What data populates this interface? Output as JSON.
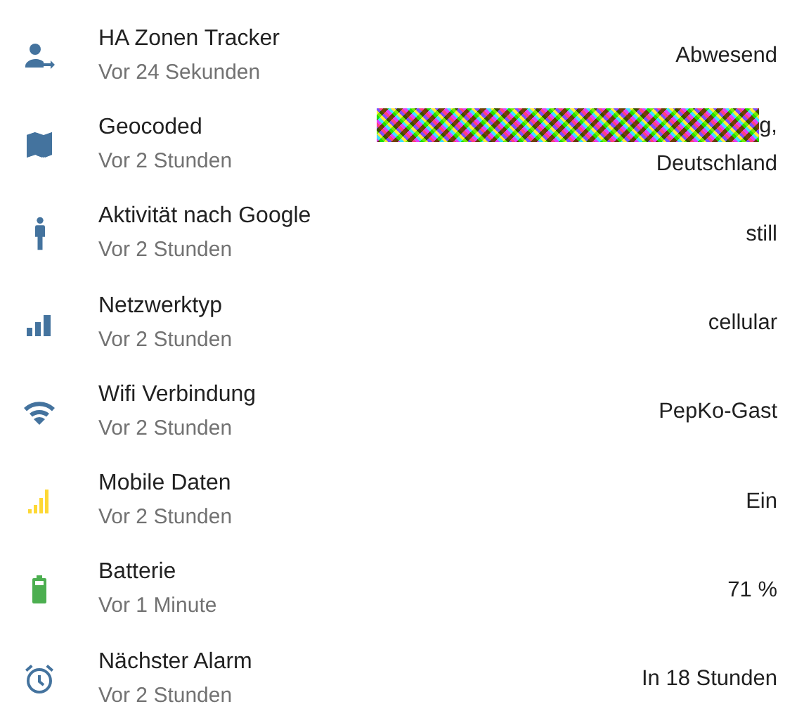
{
  "entities": [
    {
      "name": "HA Zonen Tracker",
      "time": "Vor 24 Sekunden",
      "value": [
        "Abwesend"
      ],
      "color": "#44739e"
    },
    {
      "name": "Geocoded",
      "time": "Vor 2 Stunden",
      "value": [
        "g,",
        "Deutschland"
      ],
      "redacted": true,
      "color": "#44739e"
    },
    {
      "name": "Aktivität nach Google",
      "time": "Vor 2 Stunden",
      "value": [
        "still"
      ],
      "color": "#44739e"
    },
    {
      "name": "Netzwerktyp",
      "time": "Vor 2 Stunden",
      "value": [
        "cellular"
      ],
      "color": "#44739e"
    },
    {
      "name": "Wifi Verbindung",
      "time": "Vor 2 Stunden",
      "value": [
        "PepKo-Gast"
      ],
      "color": "#44739e"
    },
    {
      "name": "Mobile Daten",
      "time": "Vor 2 Stunden",
      "value": [
        "Ein"
      ],
      "color": "#fdd835"
    },
    {
      "name": "Batterie",
      "time": "Vor 1 Minute",
      "value": [
        "71 %"
      ],
      "color": "#4caf50"
    },
    {
      "name": "Nächster Alarm",
      "time": "Vor 2 Stunden",
      "value": [
        "In 18 Stunden"
      ],
      "color": "#44739e"
    }
  ]
}
